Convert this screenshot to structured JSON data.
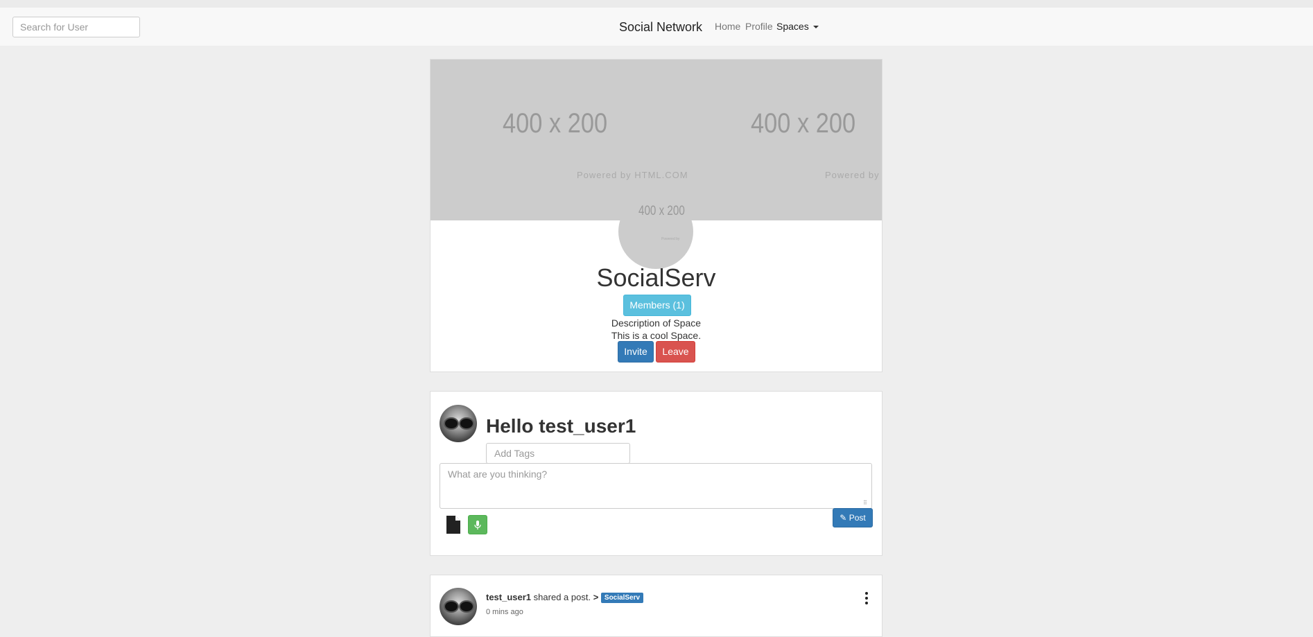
{
  "navbar": {
    "search_placeholder": "Search for User",
    "brand": "Social Network",
    "links": {
      "home": "Home",
      "profile": "Profile",
      "spaces": "Spaces"
    }
  },
  "space": {
    "cover_placeholder": {
      "left_text": "400 x 200",
      "left_powered": "Powered by HTML.COM",
      "right_text": "400 x 200",
      "right_powered": "Powered by H"
    },
    "avatar_placeholder": {
      "text": "400 x 200",
      "powered": "Powered by"
    },
    "name": "SocialServ",
    "members_button": "Members (1)",
    "description_label": "Description of Space",
    "description": "This is a cool Space.",
    "invite_button": "Invite",
    "leave_button": "Leave"
  },
  "composer": {
    "greeting": "Hello test_user1",
    "tags_placeholder": "Add Tags",
    "text_placeholder": "What are you thinking?",
    "post_button": "Post",
    "file_icon": "file-icon",
    "mic_icon": "microphone-icon"
  },
  "feed": {
    "posts": [
      {
        "author": "test_user1",
        "action": "shared a post.",
        "separator": ">",
        "space_badge": "SocialServ",
        "time": "0 mins ago"
      }
    ]
  },
  "colors": {
    "primary": "#337ab7",
    "info": "#5bc0de",
    "danger": "#d9534f",
    "success": "#5cb85c",
    "page_bg": "#eeeeee"
  }
}
